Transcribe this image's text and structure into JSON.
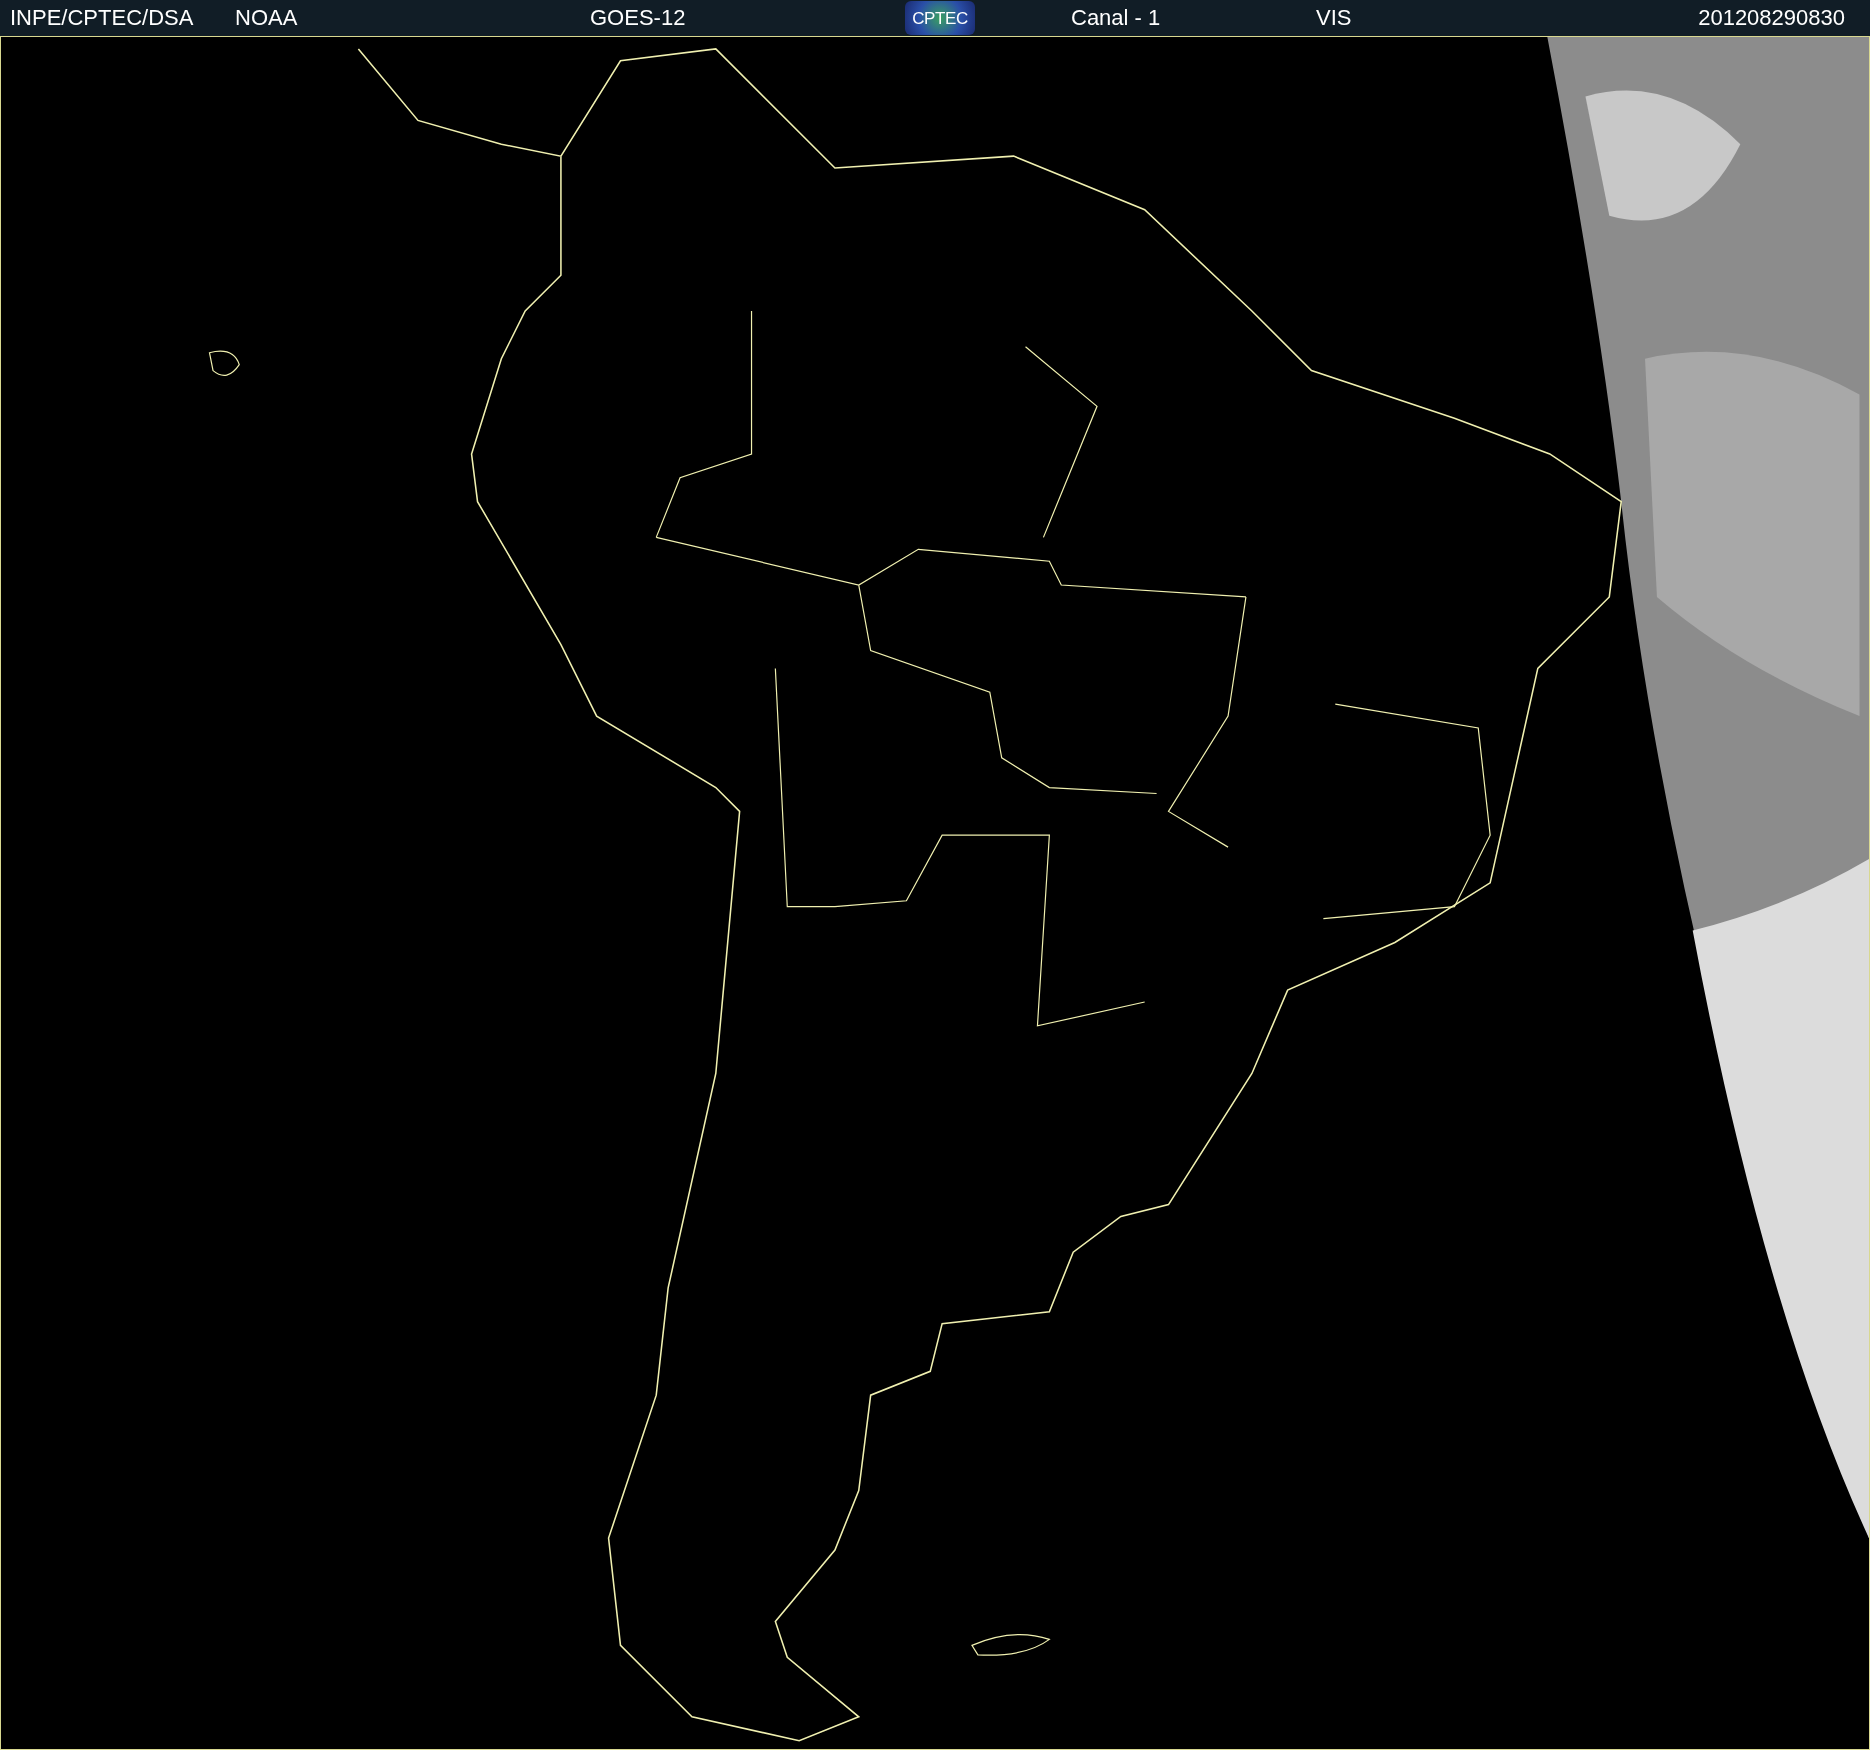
{
  "header": {
    "institution": "INPE/CPTEC/DSA",
    "agency": "NOAA",
    "satellite": "GOES-12",
    "logo": "CPTEC",
    "channel": "Canal - 1",
    "band": "VIS",
    "timestamp": "201208290830"
  }
}
